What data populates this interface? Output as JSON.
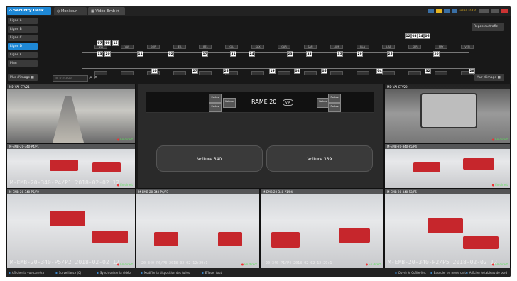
{
  "titlebar": {
    "brand": "Security Desk",
    "tabs": [
      "Moniteur",
      "Vidéo_Emb"
    ],
    "user": "user TGGO"
  },
  "lines": {
    "items": [
      "Ligne A",
      "Ligne B",
      "Ligne C",
      "Ligne D",
      "Ligne F",
      "Plan"
    ],
    "active": "Ligne D",
    "mur_left": "Mur d'image",
    "mur_right": "Mur d'image",
    "repos": "Repos du trafic",
    "search_placeholder": "Tr. rames...",
    "stations": [
      "VIA",
      "VAY",
      "GOR",
      "JEA",
      "BEL",
      "GIL",
      "SAX",
      "GAR",
      "SAN",
      "LUM",
      "BLA",
      "LAE",
      "KER",
      "PRY",
      "VEN"
    ],
    "trains_top": [
      "07",
      "09",
      "15",
      "13",
      "20",
      "11",
      "02",
      "17",
      "31",
      "24",
      "23",
      "33",
      "35",
      "29",
      "25",
      "12",
      "03",
      "14",
      "06",
      "20"
    ],
    "trains_bottom": [
      "10",
      "27",
      "26",
      "19",
      "08",
      "05",
      "04",
      "32",
      "28"
    ]
  },
  "cams": [
    {
      "title": "MD-VAI-CTV21",
      "live": "En direct",
      "stamp": ""
    },
    {
      "title": "MD-VAI-CTV22",
      "live": "En direct",
      "stamp": ""
    },
    {
      "title": "M-EMB-20-340-P4/P1",
      "live": "En direct",
      "stamp": "M-EMB-20-340-P4/P1 2018-02-02 12:"
    },
    {
      "title": "M-EMB-20-340-P5/P4",
      "live": "En direct",
      "stamp": ""
    },
    {
      "title": "M-EMB-20-340-P5/P2",
      "live": "En direct",
      "stamp": "M-EMB-20-340-P5/P2 2018-02-02 12:"
    },
    {
      "title": "M-EMB-20-340-P6/P3",
      "live": "En direct",
      "stamp": "-20-340-P6/P3 2018-02-02 12:29:1"
    },
    {
      "title": "M-EMB-20-340-P1/P4",
      "live": "En direct",
      "stamp": "-20-340-P1/P4 2018-02-02 12:29:1"
    },
    {
      "title": "M-EMB-20-340-P2/P5",
      "live": "En direct",
      "stamp": "M-EMB-20-340-P2/P5 2018-02-02 12:"
    }
  ],
  "central": {
    "rame": "RAME 20",
    "via": "VIA",
    "car1": "Voiture 340",
    "car2": "Voiture 339",
    "voiture": "Voiture",
    "portes": "Portes"
  },
  "bottombar": [
    "Afficher la vue caméra",
    "Surveillance (0)",
    "Synchroniser la vidéo",
    "Modifier la disposition des tuiles",
    "Effacer tout",
    "Ouvrir le Coffre-fort",
    "Basculer en mode carte",
    "Afficher le tableau de bord"
  ]
}
